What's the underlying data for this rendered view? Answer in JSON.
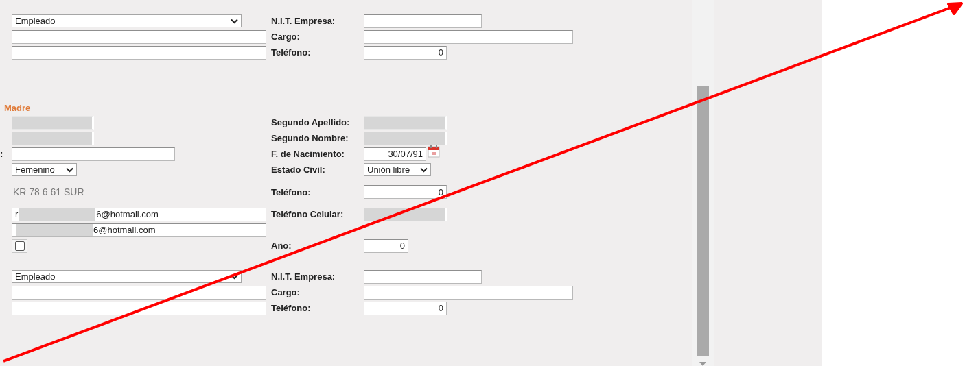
{
  "sections": [
    {
      "rows": [
        {
          "left": {
            "kind": "select",
            "value": "Empleado"
          },
          "label": "N.I.T. Empresa:",
          "right": {
            "kind": "input"
          }
        },
        {
          "left": {
            "kind": "input"
          },
          "label": "Cargo:",
          "right": {
            "kind": "input"
          }
        },
        {
          "left": {
            "kind": "input"
          },
          "label": "Teléfono:",
          "right": {
            "kind": "number",
            "value": "0"
          }
        }
      ]
    },
    {
      "heading": "Madre",
      "rows": [
        {
          "left": {
            "kind": "input",
            "masked": true
          },
          "label": "Segundo Apellido:",
          "right": {
            "kind": "input",
            "masked": true
          }
        },
        {
          "left": {
            "kind": "input",
            "masked": true
          },
          "label": "Segundo Nombre:",
          "right": {
            "kind": "input",
            "masked": true
          }
        },
        {
          "left_label": ":",
          "left": {
            "kind": "input"
          },
          "label": "F. de Nacimiento:",
          "right": {
            "kind": "date",
            "value": "30/07/91"
          }
        },
        {
          "left": {
            "kind": "select",
            "value": "Femenino"
          },
          "label": "Estado Civil:",
          "right": {
            "kind": "select",
            "value": "Unión libre"
          }
        },
        {
          "left": {
            "kind": "text",
            "value": "KR 78 6 61 SUR"
          },
          "label": "Teléfono:",
          "right": {
            "kind": "number",
            "value": "0"
          }
        },
        {
          "left": {
            "kind": "input",
            "value": "r",
            "suffix": "6@hotmail.com",
            "masked": true
          },
          "label": "Teléfono Celular:",
          "right": {
            "kind": "input",
            "masked": true
          }
        },
        {
          "left": {
            "kind": "input",
            "suffix": "6@hotmail.com",
            "masked": true
          }
        },
        {
          "left": {
            "kind": "checkbox",
            "checked": false
          },
          "label": "Año:",
          "right": {
            "kind": "number",
            "value": "0"
          }
        }
      ]
    },
    {
      "rows": [
        {
          "left": {
            "kind": "select",
            "value": "Empleado"
          },
          "label": "N.I.T. Empresa:",
          "right": {
            "kind": "input"
          }
        },
        {
          "left": {
            "kind": "input"
          },
          "label": "Cargo:",
          "right": {
            "kind": "input"
          }
        },
        {
          "left": {
            "kind": "input"
          },
          "label": "Teléfono:",
          "right": {
            "kind": "number",
            "value": "0"
          }
        }
      ]
    }
  ]
}
